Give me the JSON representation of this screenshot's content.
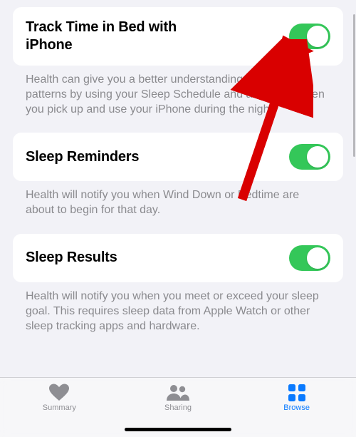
{
  "settings": [
    {
      "title": "Track Time in Bed with iPhone",
      "description": "Health can give you a better understanding of your sleep patterns by using your Sleep Schedule and analyzing when you pick up and use your iPhone during the night.",
      "toggled": true
    },
    {
      "title": "Sleep Reminders",
      "description": "Health will notify you when Wind Down or Bedtime are about to begin for that day.",
      "toggled": true
    },
    {
      "title": "Sleep Results",
      "description": "Health will notify you when you meet or exceed your sleep goal. This requires sleep data from Apple Watch or other sleep tracking apps and hardware.",
      "toggled": true
    }
  ],
  "tabs": {
    "summary": "Summary",
    "sharing": "Sharing",
    "browse": "Browse"
  },
  "colors": {
    "toggle_on": "#34c759",
    "accent": "#0a7aff",
    "arrow": "#d90000"
  }
}
